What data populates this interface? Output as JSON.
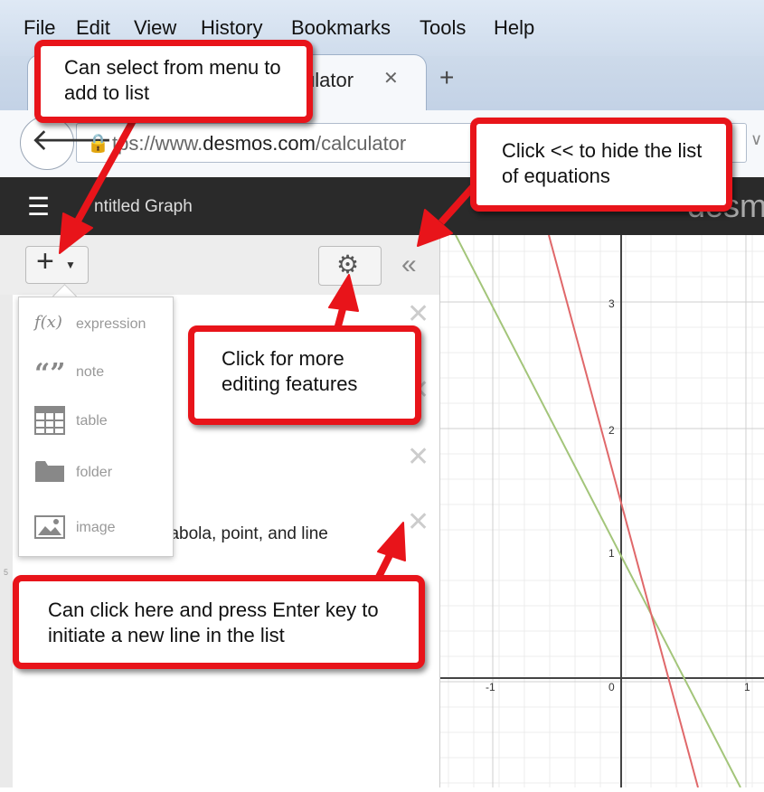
{
  "menubar": {
    "items": [
      "File",
      "Edit",
      "View",
      "History",
      "Bookmarks",
      "Tools",
      "Help"
    ]
  },
  "tab": {
    "title": "ulator",
    "close": "✕",
    "new_tab": "+"
  },
  "address": {
    "url_prefix": "tps://www.",
    "url_domain": "desmos.com",
    "url_path": "/calculator"
  },
  "desmos": {
    "graph_title": "ntitled Graph",
    "brand": "desm"
  },
  "panel": {
    "add_menu": [
      {
        "label": "expression",
        "icon": "f(x)"
      },
      {
        "label": "note",
        "icon": "“”"
      },
      {
        "label": "table",
        "icon": "table-icon"
      },
      {
        "label": "folder",
        "icon": "folder-icon"
      },
      {
        "label": "image",
        "icon": "image-icon"
      }
    ],
    "row4_text": "parabola, point, and line",
    "row5_number": "5"
  },
  "graph": {
    "x_ticks": [
      "-1",
      "0",
      "1"
    ],
    "y_ticks": [
      "3",
      "2",
      "1"
    ],
    "line_colors": {
      "red": "#e0686a",
      "green": "#a3c57a"
    }
  },
  "callouts": {
    "menu": "Can select from menu to add to list",
    "hide": "Click << to hide the list of equations",
    "edit": "Click for more editing features",
    "enter": "Can click here and press Enter key to initiate a new line in the list"
  },
  "accent": "#e8141a"
}
